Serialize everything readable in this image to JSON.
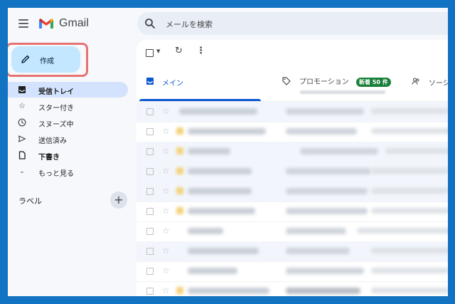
{
  "header": {
    "app_name": "Gmail",
    "search_placeholder": "メールを検索"
  },
  "compose": {
    "label": "作成"
  },
  "sidebar": {
    "items": [
      {
        "label": "受信トレイ",
        "icon": "inbox-icon",
        "active": true,
        "bold": true
      },
      {
        "label": "スター付き",
        "icon": "star-icon",
        "active": false,
        "bold": false
      },
      {
        "label": "スヌーズ中",
        "icon": "clock-icon",
        "active": false,
        "bold": false
      },
      {
        "label": "送信済み",
        "icon": "send-icon",
        "active": false,
        "bold": false
      },
      {
        "label": "下書き",
        "icon": "draft-icon",
        "active": false,
        "bold": true
      },
      {
        "label": "もっと見る",
        "icon": "chevron-down-icon",
        "active": false,
        "bold": false
      }
    ],
    "labels_title": "ラベル"
  },
  "tabs": {
    "primary": {
      "label": "メイン"
    },
    "promotions": {
      "label": "プロモーション",
      "badge": "新着 50 件"
    },
    "social": {
      "label": "ソーシャ"
    }
  },
  "colors": {
    "frame_border": "#1173c1",
    "compose_bg": "#c2e7ff",
    "active_nav": "#d3e3fd",
    "primary_tab": "#0b57d0",
    "promo_badge": "#188038",
    "highlight": "#e57373"
  }
}
